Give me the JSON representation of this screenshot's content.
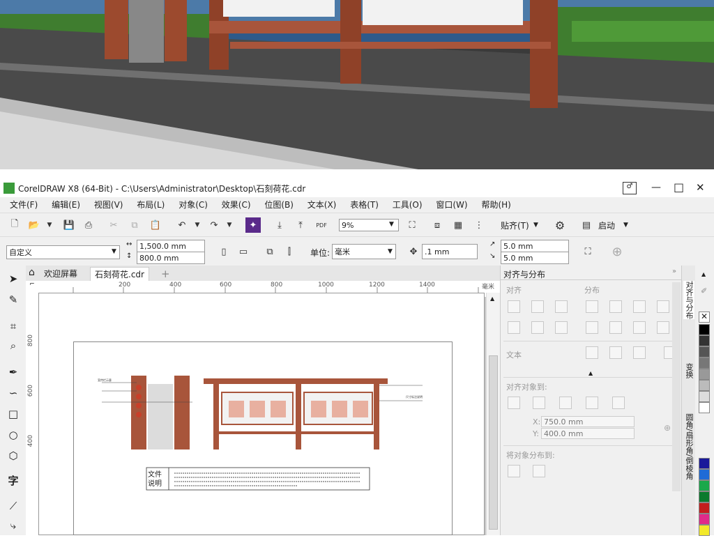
{
  "window": {
    "title": "CorelDRAW X8 (64-Bit) - C:\\Users\\Administrator\\Desktop\\石刻荷花.cdr",
    "minimize": "—",
    "maximize": "□",
    "close": "✕"
  },
  "menu": [
    "文件(F)",
    "编辑(E)",
    "视图(V)",
    "布局(L)",
    "对象(C)",
    "效果(C)",
    "位图(B)",
    "文本(X)",
    "表格(T)",
    "工具(O)",
    "窗口(W)",
    "帮助(H)"
  ],
  "toolbar": {
    "zoom_value": "9%",
    "snap_label": "贴齐(T)",
    "launch_label": "启动"
  },
  "propbar": {
    "page_preset": "自定义",
    "width": "1,500.0 mm",
    "height": "800.0 mm",
    "unit_label": "单位:",
    "unit_value": "毫米",
    "nudge": ".1 mm",
    "dup_x": "5.0 mm",
    "dup_y": "5.0 mm"
  },
  "tabs": {
    "welcome": "欢迎屏幕",
    "document": "石刻荷花.cdr",
    "add": "+"
  },
  "ruler": {
    "h_ticks": [
      "200",
      "400",
      "600",
      "800",
      "1000",
      "1200",
      "1400"
    ],
    "v_ticks": [
      "800",
      "600",
      "400"
    ],
    "unit": "毫米"
  },
  "docker": {
    "title": "对齐与分布",
    "align_label": "对齐",
    "distribute_label": "分布",
    "text_label": "文本",
    "align_to_label": "对齐对象到:",
    "x_label": "X:",
    "x_value": "750.0 mm",
    "y_label": "Y:",
    "y_value": "400.0 mm",
    "distribute_to_label": "将对象分布到:"
  },
  "side_tabs": [
    "对齐与分布",
    "变换",
    "圆角/扇形角/倒棱角"
  ],
  "drawing": {
    "file_note_title": "文件\n说明",
    "label1": "宣传栏示意",
    "label2": "尺寸标注说明"
  },
  "palette_colors": [
    "#ffffff",
    "#000000",
    "#333333",
    "#555555",
    "#777777",
    "#999999",
    "#bbbbbb",
    "#dddddd",
    "#ffffff",
    "#1a1a9a",
    "#1f6bd6",
    "#1aa84b",
    "#0b7a2e",
    "#c41e1e",
    "#e02a8a",
    "#f2e92a"
  ],
  "colors": {
    "frame_brown": "#a8553b",
    "corel_green": "#3a9b3a"
  }
}
